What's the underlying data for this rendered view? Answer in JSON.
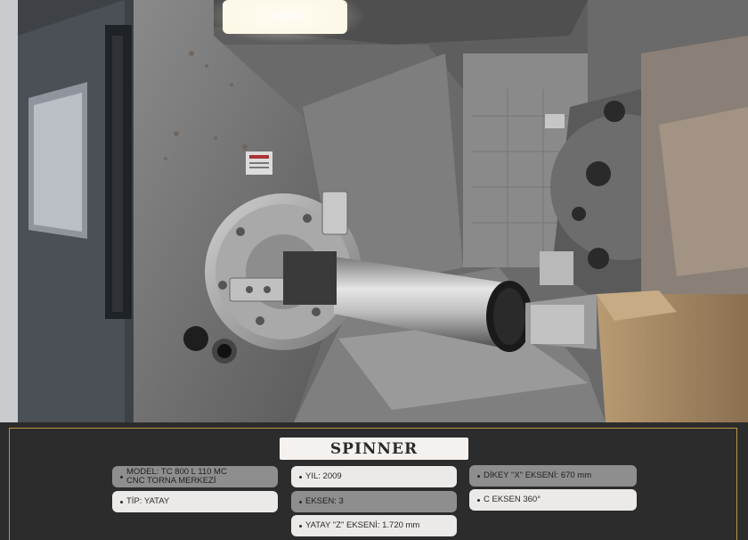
{
  "brand": {
    "name": "SPINNER"
  },
  "specs": {
    "model": {
      "line1": "MODEL: TC 800 L 110 MC",
      "line2": "CNC TORNA MERKEZİ"
    },
    "tip": "TİP: YATAY",
    "yil": "YIL: 2009",
    "eksen": "EKSEN: 3",
    "yatay_z": "YATAY \"Z\" EKSENİ: 1.720 mm",
    "dikey_x": "DİKEY \"X\" EKSENİ: 670 mm",
    "c_eksen": "C EKSEN 360°"
  },
  "colors": {
    "panel_bg": "#2c2c2c",
    "frame_gold": "#b89a3c",
    "chip_light": "#eceae8",
    "chip_dark": "#8e8e8e",
    "brand_bg": "#f4f1ee"
  }
}
